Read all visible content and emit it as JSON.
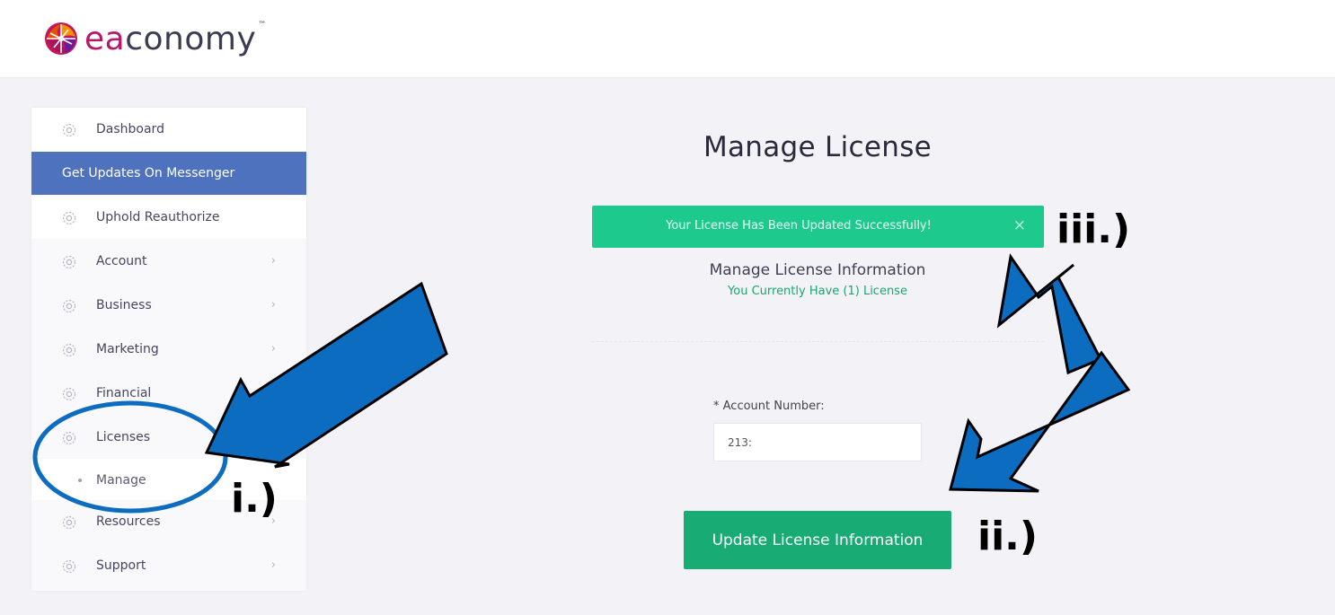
{
  "brand": {
    "logo_prefix": "ea",
    "logo_suffix": "conomy",
    "logo_tm": "™"
  },
  "sidebar": {
    "items": [
      {
        "label": "Dashboard",
        "icon": "gear-icon"
      },
      {
        "label": "Get Updates On Messenger"
      },
      {
        "label": "Uphold Reauthorize",
        "icon": "gear-icon"
      },
      {
        "label": "Account",
        "icon": "gear-icon",
        "chevron": "›"
      },
      {
        "label": "Business",
        "icon": "gear-icon",
        "chevron": "›"
      },
      {
        "label": "Marketing",
        "icon": "gear-icon",
        "chevron": "›"
      },
      {
        "label": "Financial",
        "icon": "gear-icon"
      },
      {
        "label": "Licenses",
        "icon": "gear-icon"
      },
      {
        "label": "Manage"
      },
      {
        "label": "Resources",
        "icon": "gear-icon",
        "chevron": "›"
      },
      {
        "label": "Support",
        "icon": "gear-icon",
        "chevron": "›"
      }
    ]
  },
  "main": {
    "title": "Manage License",
    "alert": {
      "message": "Your License Has Been Updated Successfully!",
      "close": "×"
    },
    "info_title": "Manage License Information",
    "info_subtitle": "You Currently Have (1) License",
    "account_label": "* Account Number:",
    "account_value": "213:",
    "update_button": "Update License Information"
  },
  "annotations": {
    "i": "i.)",
    "ii": "ii.)",
    "iii": "iii.)"
  },
  "colors": {
    "messenger_bg": "#4f72bf",
    "alert_bg": "#1ec98d",
    "button_bg": "#18ab74",
    "arrow_fill": "#0b6cc0",
    "brand_accent": "#b8186b"
  }
}
